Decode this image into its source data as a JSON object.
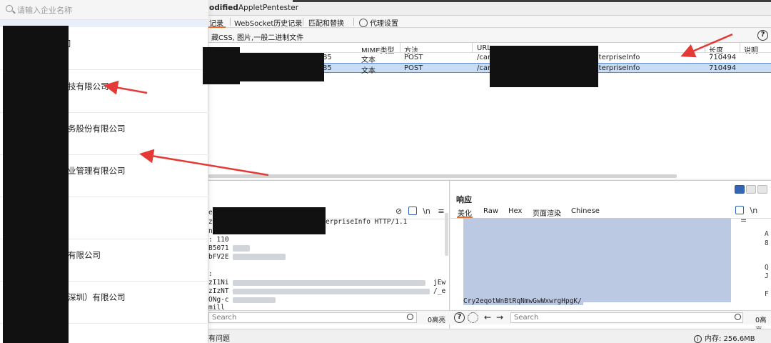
{
  "tabs": {
    "items": [
      "odified",
      "AppletPentester"
    ]
  },
  "subtabs": {
    "items": [
      "记录",
      "WebSocket历史记录",
      "匹配和替换",
      "代理设置"
    ]
  },
  "filter": {
    "text": "藏CSS, 图片,一般二进制文件",
    "help": "?"
  },
  "history_table": {
    "columns": [
      "MIME类型",
      "方法",
      "URL",
      "长度",
      "说明"
    ],
    "rows": [
      {
        "frag": "85",
        "mime": "文本",
        "method": "POST",
        "url_start": "/car",
        "url_end": "EnterpriseInfo",
        "length": "710494",
        "selected": false
      },
      {
        "frag": "85",
        "mime": "文本",
        "method": "POST",
        "url_start": "/car",
        "url_end": "EnterpriseInfo",
        "length": "710494",
        "selected": true
      }
    ]
  },
  "request": {
    "lines": [
      "e:",
      "z:",
      "ni",
      ": 110",
      "B5071",
      "bFV2E",
      "",
      ":",
      "zI1Ni",
      "zIzNT",
      "ONg-c",
      "mill"
    ],
    "line_tail": "erpriseInfo HTTP/1.1",
    "right_frags": [
      "jEw",
      "/_e"
    ],
    "icons_newline": "\\n",
    "icons_menu": "≡"
  },
  "response": {
    "title": "响应",
    "tabs": [
      "美化",
      "Raw",
      "Hex",
      "页面渲染",
      "Chinese"
    ],
    "last_line": "Cry2eqotWnBtRqNmwGwWxwrgHpgK/",
    "right_chars": [
      "A",
      "8",
      "Q",
      "J",
      "F"
    ],
    "icons_newline": "\\n",
    "icons_menu": "≡"
  },
  "search_bars": {
    "placeholder": "Search",
    "hits": "0高亮"
  },
  "status": {
    "left": "有问题",
    "memory": "内存: 256.6MB"
  },
  "picker": {
    "placeholder": "请输入企业名称",
    "items": [
      "司",
      "技有限公司",
      "务股份有限公司",
      "业管理有限公司",
      "",
      "有限公司",
      "深圳）有限公司"
    ]
  },
  "colors": {
    "accent": "#e8702a",
    "selection": "#c8dcf4",
    "response_highlight": "#bcc9e2",
    "arrow": "#e53935",
    "redaction": "#111111"
  }
}
